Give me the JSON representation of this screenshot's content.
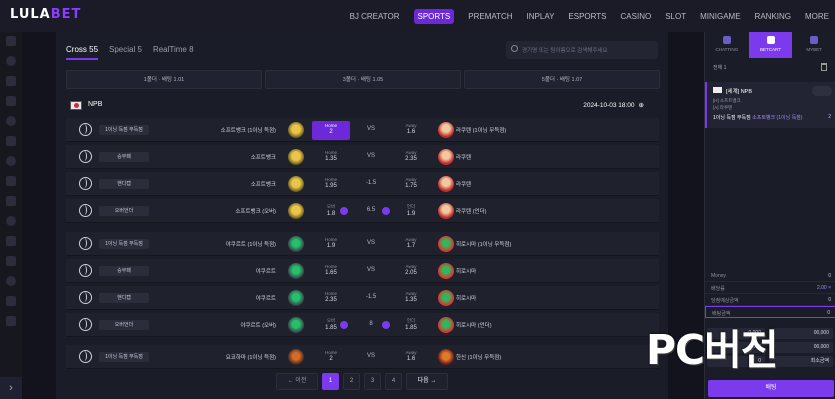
{
  "brand": {
    "part1": "LULA",
    "part2": "BET"
  },
  "nav": [
    "BJ CREATOR",
    "SPORTS",
    "PREMATCH",
    "INPLAY",
    "ESPORTS",
    "CASINO",
    "SLOT",
    "MINIGAME",
    "RANKING",
    "MORE"
  ],
  "nav_active": "SPORTS",
  "tabs": [
    "Cross 55",
    "Special 5",
    "RealTime 8"
  ],
  "search_placeholder": "경기명 또는 팀이름으로 검색해주세요",
  "stats": [
    "1폴더 · 배팅 1.01",
    "3폴더 · 배팅 1.05",
    "5폴더 · 배팅 1.07"
  ],
  "league": {
    "name": "NPB",
    "time": "2024-10-03  18:00",
    "pin_icon": "⊕"
  },
  "vs_label": "VS",
  "games": [
    {
      "market": "1이닝 득점 무득점",
      "home": "소프트뱅크 (1이닝 득점)",
      "home_label": "Home",
      "home_odd": "2",
      "mid": "VS",
      "away_label": "Away",
      "away_odd": "1.6",
      "away": "라쿠텐 (1이닝 무득점)",
      "selected": "home",
      "hc": "c1",
      "ac": "a1"
    },
    {
      "market": "승무패",
      "home": "소프트뱅크",
      "home_label": "Home",
      "home_odd": "1.35",
      "mid": "VS",
      "away_label": "Away",
      "away_odd": "2.35",
      "away": "라쿠텐",
      "selected": "",
      "hc": "c1",
      "ac": "a1"
    },
    {
      "market": "핸디캡",
      "home": "소프트뱅크",
      "home_label": "Home",
      "home_odd": "1.95",
      "mid": "-1.5",
      "away_label": "Away",
      "away_odd": "1.75",
      "away": "라쿠텐",
      "selected": "",
      "hc": "c1",
      "ac": "a1"
    },
    {
      "market": "오버언더",
      "home": "소프트뱅크 (오버)",
      "home_label": "오버",
      "home_odd": "1.8",
      "mid": "6.5",
      "away_label": "언더",
      "away_odd": "1.9",
      "away": "라쿠텐 (언더)",
      "selected": "",
      "hc": "c1",
      "ac": "a1",
      "ou": true
    },
    {
      "market": "1이닝 득점 무득점",
      "home": "야쿠르트 (1이닝 득점)",
      "home_label": "Home",
      "home_odd": "1.9",
      "mid": "VS",
      "away_label": "Away",
      "away_odd": "1.7",
      "away": "히로시마 (1이닝 무득점)",
      "selected": "",
      "hc": "c2",
      "ac": "a2"
    },
    {
      "market": "승무패",
      "home": "야쿠르트",
      "home_label": "Home",
      "home_odd": "1.65",
      "mid": "VS",
      "away_label": "Away",
      "away_odd": "2.05",
      "away": "히로시마",
      "selected": "",
      "hc": "c2",
      "ac": "a2"
    },
    {
      "market": "핸디캡",
      "home": "야쿠르트",
      "home_label": "Home",
      "home_odd": "2.35",
      "mid": "-1.5",
      "away_label": "Away",
      "away_odd": "1.35",
      "away": "히로시마",
      "selected": "",
      "hc": "c2",
      "ac": "a2"
    },
    {
      "market": "오버언더",
      "home": "야쿠르트 (오버)",
      "home_label": "오버",
      "home_odd": "1.85",
      "mid": "8",
      "away_label": "언더",
      "away_odd": "1.85",
      "away": "히로시마 (언더)",
      "selected": "",
      "hc": "c2",
      "ac": "a2",
      "ou": true
    },
    {
      "market": "1이닝 득점 무득점",
      "home": "요코하마 (1이닝 득점)",
      "home_label": "Home",
      "home_odd": "2",
      "mid": "VS",
      "away_label": "Away",
      "away_odd": "1.6",
      "away": "한신 (1이닝 무득점)",
      "selected": "",
      "hc": "c3",
      "ac": "a3"
    }
  ],
  "pager": {
    "prev": "← 이전",
    "pages": [
      "1",
      "2",
      "3",
      "4"
    ],
    "active": "1",
    "next": "다음 →"
  },
  "right": {
    "tabs": [
      "CHATTING",
      "BETCART",
      "MYBET"
    ],
    "active_tab": "BETCART",
    "count": "전체  1",
    "card": {
      "league": "[세계]  NPB",
      "line1": "[H] 소프트뱅크",
      "line2": "[A] 라쿠텐",
      "sel_prefix": "1이닝 득점 무득점",
      "pick": "소프트뱅크 (1이닝 득점)",
      "odd": "2"
    },
    "slip": [
      {
        "label": "Money",
        "value": "0"
      },
      {
        "label": "배당률",
        "value": "2.00 ×"
      },
      {
        "label": "당첨예상금액",
        "value": "0"
      },
      {
        "label": "배팅금액",
        "value": "0"
      }
    ],
    "chips": [
      "0,000",
      "00,000",
      "0,000",
      "00,000",
      "0",
      "최소금액"
    ],
    "bet_button": "배팅"
  },
  "watermark": "PC버전",
  "rail_arrow": "›"
}
